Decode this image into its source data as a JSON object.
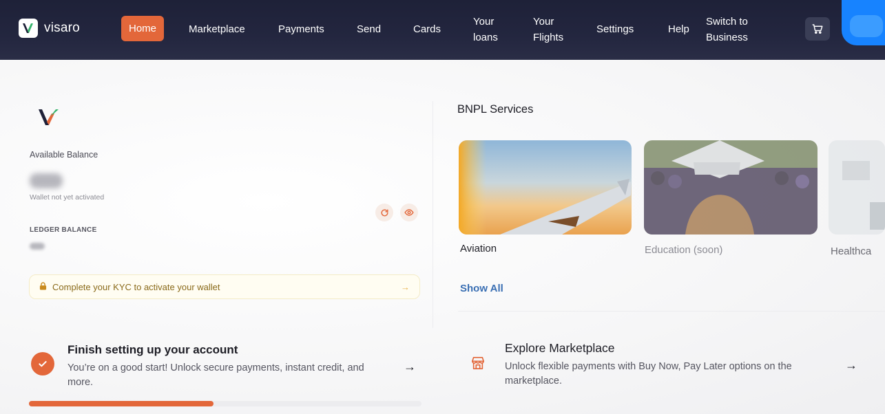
{
  "brand": {
    "name": "visaro",
    "logo_letter": "V"
  },
  "nav": {
    "home": "Home",
    "marketplace": "Marketplace",
    "payments": "Payments",
    "send": "Send",
    "cards": "Cards",
    "loans_line1": "Your",
    "loans_line2": "loans",
    "flights_line1": "Your",
    "flights_line2": "Flights",
    "settings": "Settings",
    "help": "Help",
    "business_line1": "Switch to",
    "business_line2": "Business"
  },
  "wallet": {
    "available_label": "Available Balance",
    "status_note": "Wallet not yet activated",
    "ledger_label": "LEDGER BALANCE",
    "kyc_message": "Complete your KYC to activate your wallet",
    "kyc_arrow": "→"
  },
  "bnpl": {
    "title": "BNPL Services",
    "services": [
      {
        "label": "Aviation"
      },
      {
        "label": "Education (soon)"
      },
      {
        "label": "Healthca"
      }
    ],
    "show_all": "Show All"
  },
  "setup": {
    "title": "Finish setting up your account",
    "description": "You’re on a good start! Unlock secure payments, instant credit, and more.",
    "progress_fraction": 0.47,
    "arrow": "→"
  },
  "explore": {
    "title": "Explore Marketplace",
    "description": "Unlock flexible payments with Buy Now, Pay Later options on the marketplace.",
    "arrow": "→"
  },
  "colors": {
    "accent": "#e3673a",
    "nav_bg": "#1e2138",
    "link": "#3a6fb3",
    "avatar": "#1783ff"
  },
  "icons": {
    "cart": "cart-icon",
    "refresh": "refresh-icon",
    "eye": "eye-icon",
    "lock": "lock-icon",
    "check": "check-icon",
    "store": "store-icon"
  }
}
